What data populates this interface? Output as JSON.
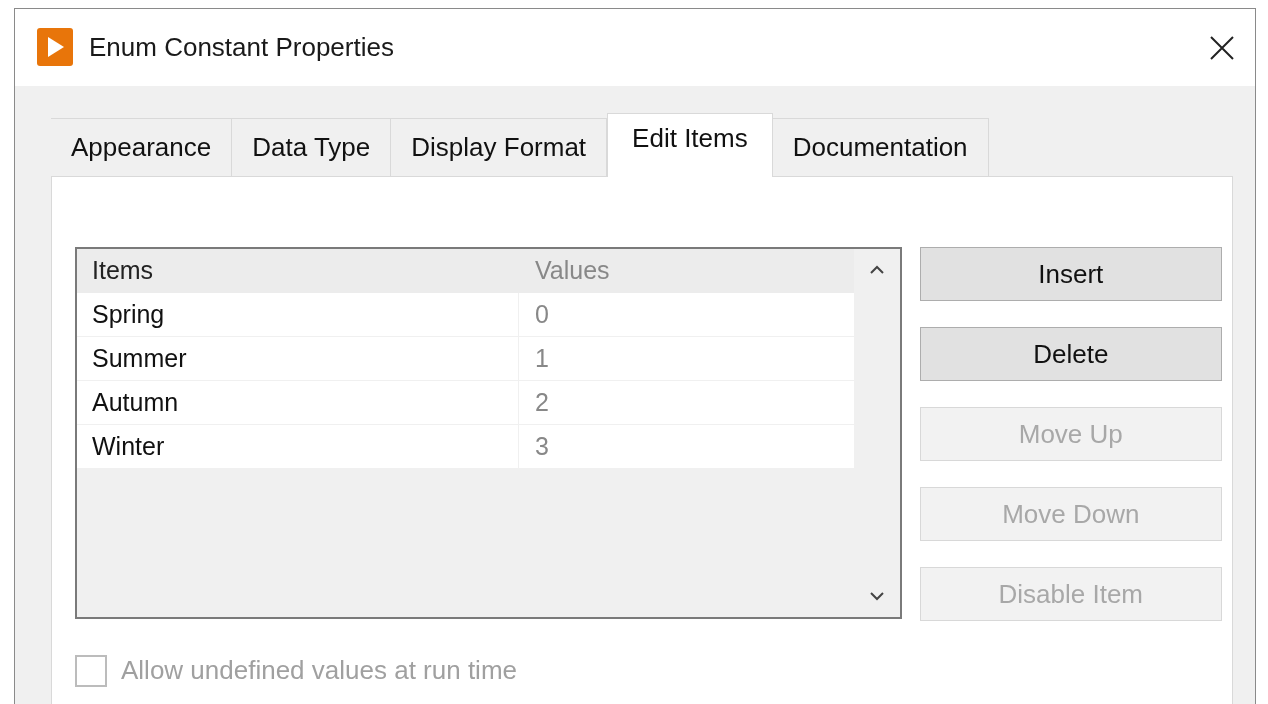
{
  "window": {
    "title": "Enum Constant Properties"
  },
  "tabs": [
    {
      "label": "Appearance",
      "selected": false
    },
    {
      "label": "Data Type",
      "selected": false
    },
    {
      "label": "Display Format",
      "selected": false
    },
    {
      "label": "Edit Items",
      "selected": true
    },
    {
      "label": "Documentation",
      "selected": false
    }
  ],
  "table": {
    "columns": [
      "Items",
      "Values"
    ],
    "rows": [
      {
        "item": "Spring",
        "value": "0"
      },
      {
        "item": "Summer",
        "value": "1"
      },
      {
        "item": "Autumn",
        "value": "2"
      },
      {
        "item": "Winter",
        "value": "3"
      }
    ]
  },
  "buttons": [
    {
      "label": "Insert",
      "disabled": false
    },
    {
      "label": "Delete",
      "disabled": false
    },
    {
      "label": "Move Up",
      "disabled": true
    },
    {
      "label": "Move Down",
      "disabled": true
    },
    {
      "label": "Disable Item",
      "disabled": true
    }
  ],
  "checkbox": {
    "label": "Allow undefined values at run time",
    "checked": false,
    "disabled": true
  }
}
